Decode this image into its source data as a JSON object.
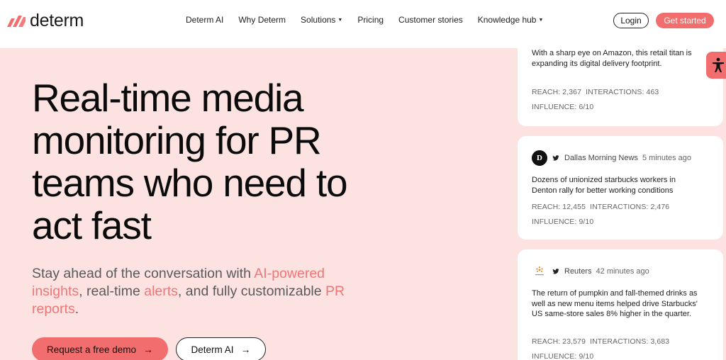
{
  "brand": {
    "name": "determ"
  },
  "nav": {
    "items": [
      {
        "label": "Determ AI",
        "has_dropdown": false
      },
      {
        "label": "Why Determ",
        "has_dropdown": false
      },
      {
        "label": "Solutions",
        "has_dropdown": true
      },
      {
        "label": "Pricing",
        "has_dropdown": false
      },
      {
        "label": "Customer stories",
        "has_dropdown": false
      },
      {
        "label": "Knowledge hub",
        "has_dropdown": true
      }
    ],
    "login_label": "Login",
    "get_started_label": "Get started"
  },
  "hero": {
    "title_lines": [
      "Real-time media",
      "monitoring for PR",
      "teams who need to",
      "act fast"
    ],
    "subtitle": {
      "part1": "Stay ahead of the conversation with ",
      "hl1": "AI-powered insights",
      "part2": ", real-time ",
      "hl2": "alerts",
      "part3": ", and fully customizable ",
      "hl3": "PR reports",
      "part4": "."
    },
    "demo_button_label": "Request a free demo",
    "ai_button_label": "Determ AI",
    "arrow": "→"
  },
  "feed": {
    "cards": [
      {
        "text": "With a sharp eye on Amazon, this retail titan is expanding its digital delivery footprint.",
        "reach": "REACH: 2,367",
        "interactions": "INTERACTIONS: 463",
        "influence": "INFLUENCE: 6/10"
      },
      {
        "source": "Dallas Morning News",
        "time": "5 minutes ago",
        "avatar_letter": "D",
        "text": "Dozens of unionized starbucks workers in Denton rally for better working conditions",
        "reach": "REACH: 12,455",
        "interactions": "INTERACTIONS: 2,476",
        "influence": "INFLUENCE: 9/10"
      },
      {
        "source": "Reuters",
        "time": "42 minutes ago",
        "text": "The return of pumpkin and fall-themed drinks as well as new menu items helped drive Starbucks' US same-store sales 8% higher in the quarter.",
        "reach": "REACH: 23,579",
        "interactions": "INTERACTIONS: 3,683",
        "influence": "INFLUENCE: 9/10"
      }
    ]
  },
  "icons": {
    "social": "twitter-bird-icon",
    "accessibility": "accessibility-person-icon"
  },
  "colors": {
    "accent": "#f26d6d",
    "hero_bg": "#fde2e2",
    "highlight_text": "#f07676"
  }
}
